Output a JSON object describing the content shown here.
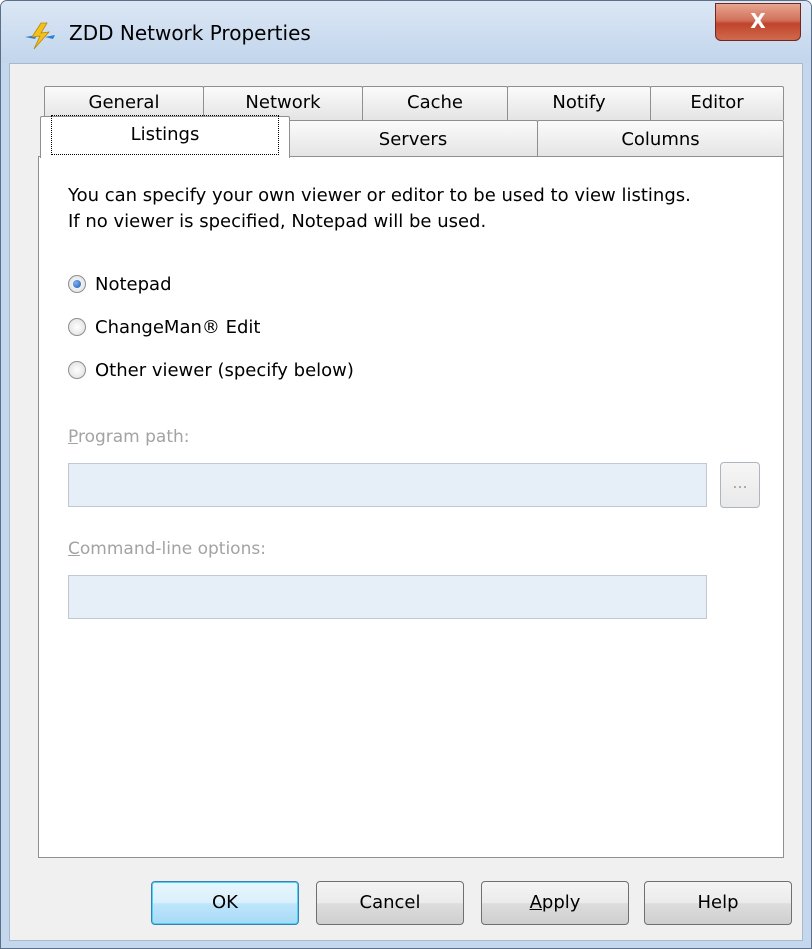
{
  "window": {
    "title": "ZDD Network Properties",
    "close_label": "X"
  },
  "tabs": {
    "row1": [
      {
        "label": "General"
      },
      {
        "label": "Network"
      },
      {
        "label": "Cache"
      },
      {
        "label": "Notify"
      },
      {
        "label": "Editor"
      }
    ],
    "row2": [
      {
        "label": "Listings",
        "selected": true
      },
      {
        "label": "Servers"
      },
      {
        "label": "Columns"
      }
    ]
  },
  "listings": {
    "description_line1": "You can specify your own viewer or editor to be used to view listings.",
    "description_line2": "If no viewer is specified, Notepad will be used.",
    "options": [
      {
        "label": "Notepad",
        "checked": true
      },
      {
        "label": "ChangeMan® Edit",
        "checked": false
      },
      {
        "label": "Other viewer (specify below)",
        "checked": false
      }
    ],
    "program_path": {
      "label_mnemonic": "P",
      "label_rest": "rogram path:",
      "value": ""
    },
    "browse_label": "...",
    "command_line": {
      "label_mnemonic": "C",
      "label_rest": "ommand-line options:",
      "value": ""
    }
  },
  "buttons": {
    "ok": "OK",
    "cancel": "Cancel",
    "apply_mnemonic": "A",
    "apply_rest": "pply",
    "help": "Help"
  },
  "colors": {
    "accent": "#1b57b5",
    "disabled_text": "#a3a3a3",
    "close_button": "#c0442a"
  }
}
